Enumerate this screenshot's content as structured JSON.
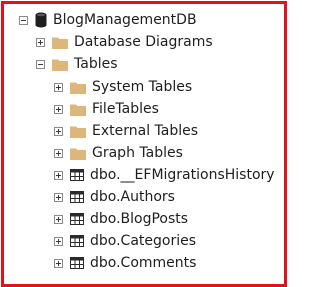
{
  "tree": {
    "database": {
      "label": "BlogManagementDB",
      "icon": "database-icon",
      "expander": "collapse"
    },
    "diagrams": {
      "label": "Database Diagrams",
      "icon": "folder-icon",
      "expander": "expand"
    },
    "tables": {
      "label": "Tables",
      "icon": "folder-icon",
      "expander": "collapse",
      "folders": [
        {
          "label": "System Tables",
          "icon": "folder-icon"
        },
        {
          "label": "FileTables",
          "icon": "folder-icon"
        },
        {
          "label": "External Tables",
          "icon": "folder-icon"
        },
        {
          "label": "Graph Tables",
          "icon": "folder-icon"
        }
      ],
      "items": [
        {
          "label": "dbo.__EFMigrationsHistory",
          "icon": "table-icon"
        },
        {
          "label": "dbo.Authors",
          "icon": "table-icon"
        },
        {
          "label": "dbo.BlogPosts",
          "icon": "table-icon"
        },
        {
          "label": "dbo.Categories",
          "icon": "table-icon"
        },
        {
          "label": "dbo.Comments",
          "icon": "table-icon"
        }
      ]
    }
  },
  "colors": {
    "highlight_border": "#e0131b",
    "folder": "#dcb67a",
    "database": "#1e1e1e",
    "table": "#2b2b2b"
  }
}
